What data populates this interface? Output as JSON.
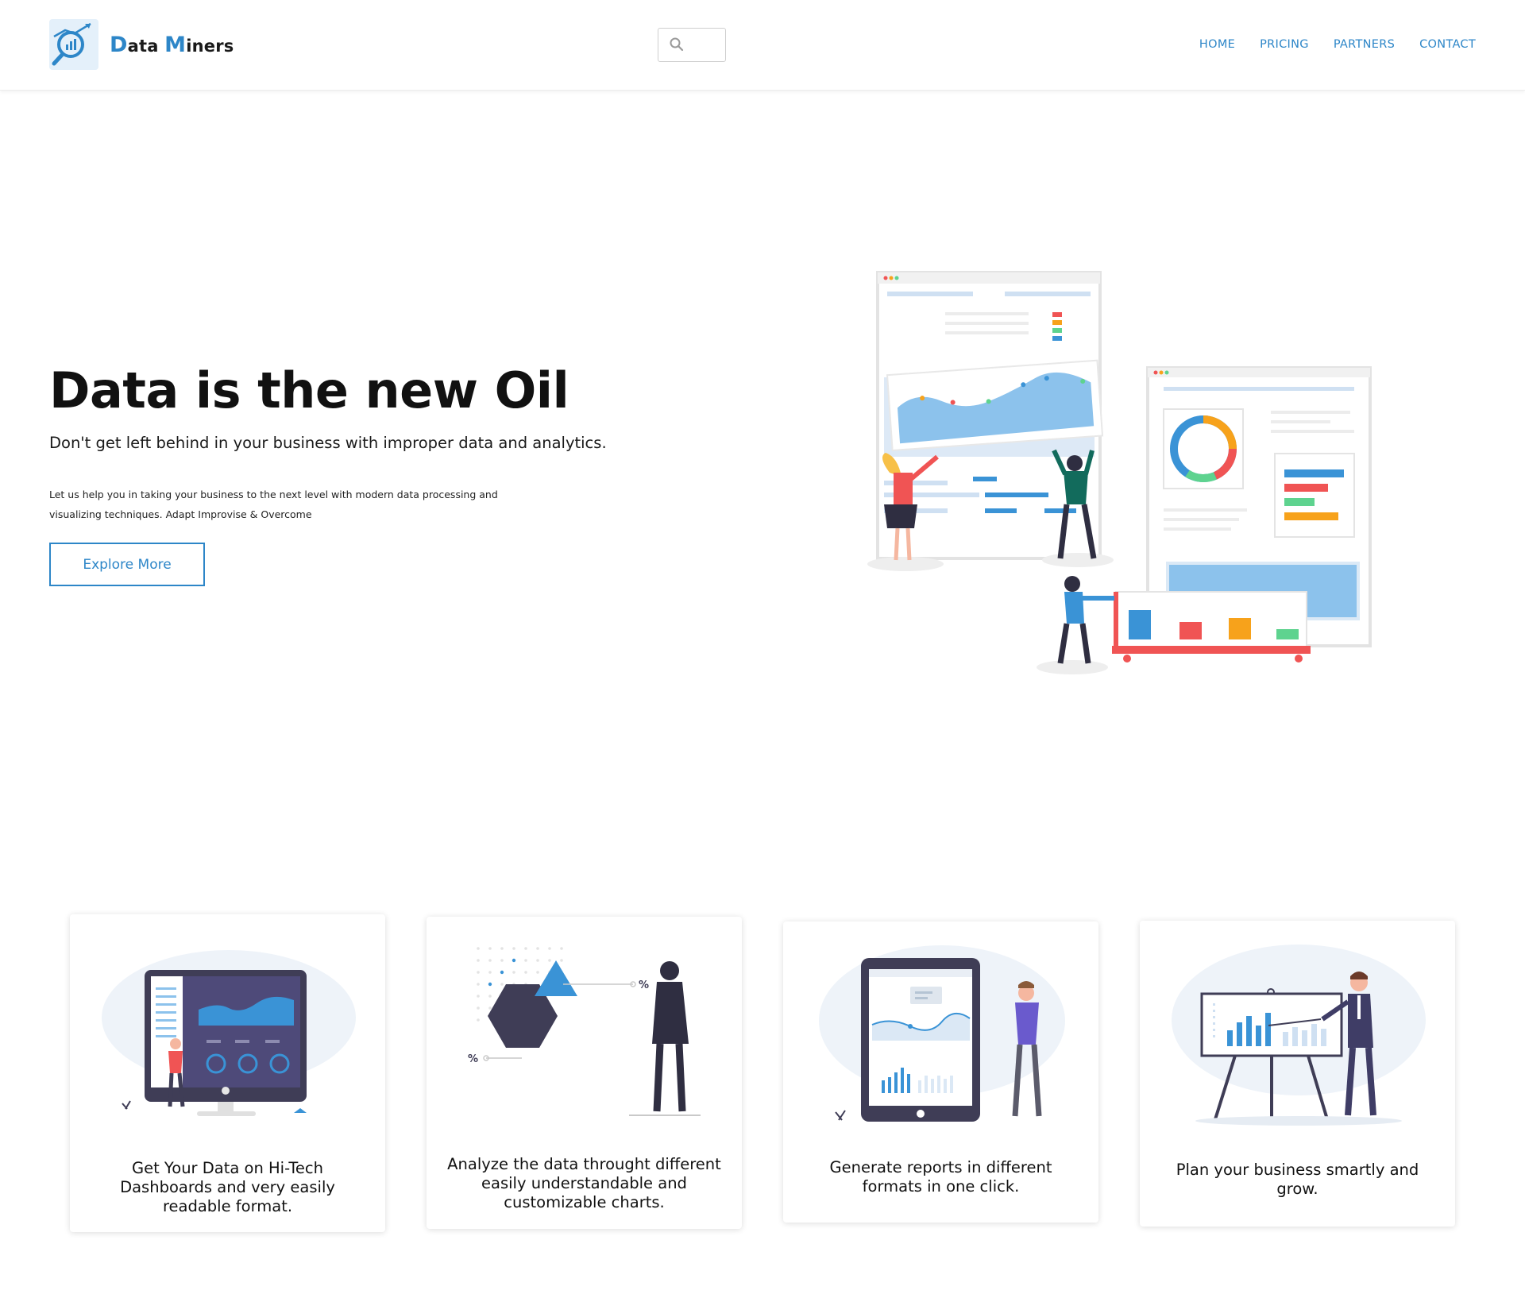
{
  "brand": {
    "name_first_initial": "D",
    "name_first_rest": "ata",
    "name_second_initial": "M",
    "name_second_rest": "iners",
    "icon": "magnifier-chart-logo-icon"
  },
  "search": {
    "placeholder": "",
    "icon": "search-icon"
  },
  "nav": {
    "items": [
      {
        "label": "HOME"
      },
      {
        "label": "PRICING"
      },
      {
        "label": "PARTNERS"
      },
      {
        "label": "CONTACT"
      }
    ]
  },
  "hero": {
    "title": "Data is the new Oil",
    "subtitle": "Don't get left behind in your business with improper data and analytics.",
    "body_line1": "Let us help you in taking your business to the next level with modern data processing and",
    "body_line2": "visualizing techniques. Adapt Improvise & Overcome",
    "cta_label": "Explore More",
    "illustration": "analytics-team-dashboards-illustration"
  },
  "features": [
    {
      "text_lines": [
        "Get Your Data on Hi-Tech",
        "Dashboards and very easily",
        "readable format."
      ],
      "illustration": "dashboard-monitor-illustration"
    },
    {
      "text_lines": [
        "Analyze the data throught different",
        "easily understandable and",
        "customizable charts."
      ],
      "illustration": "chart-shapes-illustration"
    },
    {
      "text_lines": [
        "Generate reports in different",
        "formats in one click."
      ],
      "illustration": "tablet-report-illustration"
    },
    {
      "text_lines": [
        "Plan your business smartly and",
        "grow."
      ],
      "illustration": "presentation-board-illustration"
    }
  ],
  "colors": {
    "accent": "#2d86c8",
    "text": "#111111",
    "red": "#f05454",
    "orange": "#f7a21b",
    "green": "#5ed38f",
    "blue": "#3a93d6",
    "navy": "#3f3d56"
  }
}
